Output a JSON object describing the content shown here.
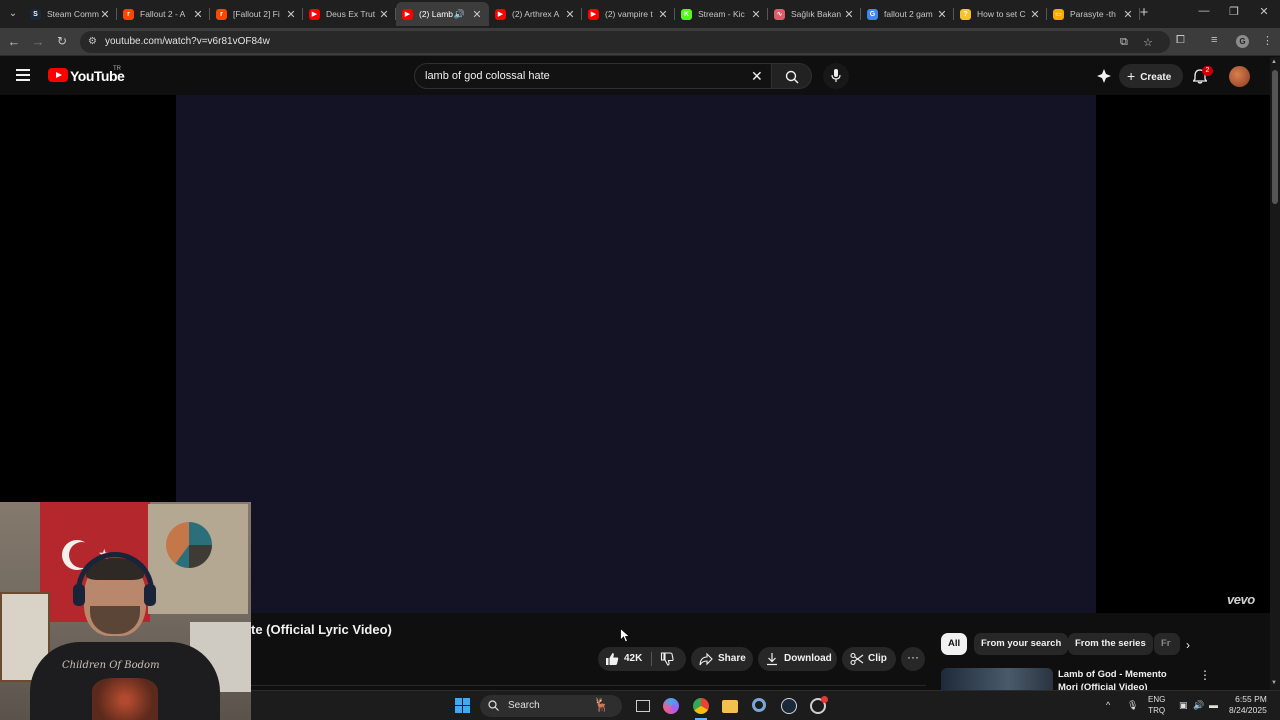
{
  "browser": {
    "tabs": [
      {
        "label": "Steam Comm",
        "color": "#1b2838",
        "glyph": "S",
        "active": false
      },
      {
        "label": "Fallout 2 - A",
        "color": "#ff4500",
        "glyph": "r",
        "active": false
      },
      {
        "label": "[Fallout 2] Fi",
        "color": "#ff4500",
        "glyph": "r",
        "active": false
      },
      {
        "label": "Deus Ex Trut",
        "color": "#ff0000",
        "glyph": "▶",
        "active": false
      },
      {
        "label": "(2) Lamb",
        "color": "#ff0000",
        "glyph": "▶",
        "active": true,
        "audio": true
      },
      {
        "label": "(2) Arthrex A",
        "color": "#ff0000",
        "glyph": "▶",
        "active": false
      },
      {
        "label": "(2) vampire t",
        "color": "#ff0000",
        "glyph": "▶",
        "active": false
      },
      {
        "label": "Stream - Kic",
        "color": "#53fc18",
        "glyph": "K",
        "active": false
      },
      {
        "label": "Sağlık Bakan",
        "color": "#e05a6a",
        "glyph": "∿",
        "active": false
      },
      {
        "label": "fallout 2 gam",
        "color": "#4285f4",
        "glyph": "G",
        "active": false
      },
      {
        "label": "How to set C",
        "color": "#f4c430",
        "glyph": "?",
        "active": false
      },
      {
        "label": "Parasyte -th",
        "color": "#f9ab00",
        "glyph": "▭",
        "active": false
      }
    ],
    "url": "youtube.com/watch?v=v6r81vOF84w",
    "profile_letter": "G"
  },
  "youtube": {
    "logo_text": "YouTube",
    "region": "TR",
    "search_value": "lamb of god colossal hate",
    "create_label": "Create",
    "notification_count": "2",
    "watermark": "vevo",
    "video_title": "te (Official Lyric Video)",
    "like_count": "42K",
    "share_label": "Share",
    "download_label": "Download",
    "clip_label": "Clip",
    "more_label": "···",
    "chips": [
      {
        "label": "All",
        "active": true
      },
      {
        "label": "From your search",
        "active": false
      },
      {
        "label": "From the series",
        "active": false
      },
      {
        "label": "Fr",
        "active": false
      }
    ],
    "recommendation": {
      "title": "Lamb of God - Memento Mori (Official Video)"
    }
  },
  "webcam": {
    "shirt_text": "Children Of Bodom"
  },
  "taskbar": {
    "search_label": "Search",
    "lang_line1": "ENG",
    "lang_line2": "TRQ",
    "time": "6:55 PM",
    "date": "8/24/2025"
  },
  "colors": {
    "youtube_red": "#ff0000",
    "player_bg": "#131325",
    "page_bg": "#0f0f0f"
  }
}
